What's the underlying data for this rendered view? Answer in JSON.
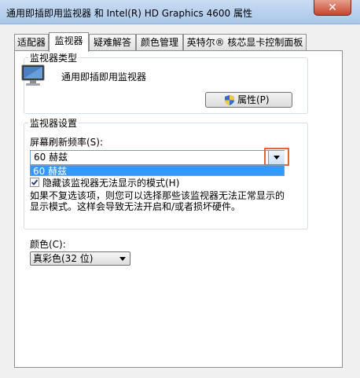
{
  "window": {
    "title": "通用即插即用监视器 和 Intel(R) HD Graphics 4600 属性",
    "close_label": "✕"
  },
  "tabs": [
    {
      "label": "适配器"
    },
    {
      "label": "监视器"
    },
    {
      "label": "疑难解答"
    },
    {
      "label": "颜色管理"
    },
    {
      "label": "英特尔® 核芯显卡控制面板"
    }
  ],
  "monitor_type": {
    "group_label": "监视器类型",
    "device_name": "通用即插即用监视器",
    "properties_button": "属性(P)"
  },
  "monitor_settings": {
    "group_label": "监视器设置",
    "refresh_label": "屏幕刷新频率(S):",
    "refresh_value": "60 赫兹",
    "refresh_options": [
      "60 赫兹"
    ],
    "hide_modes_label": "隐藏该监视器无法显示的模式(H)",
    "hide_modes_checked": true,
    "warning_line1": "如果不复选该项，则您可以选择那些该监视器无法正常显示的",
    "warning_line2": "显示模式。这样会导致无法开启和/或者损坏硬件。"
  },
  "colors": {
    "label": "颜色(C):",
    "value": "真彩色(32 位)"
  },
  "highlight_color": "#e8623a",
  "selection_color": "#3399ff"
}
